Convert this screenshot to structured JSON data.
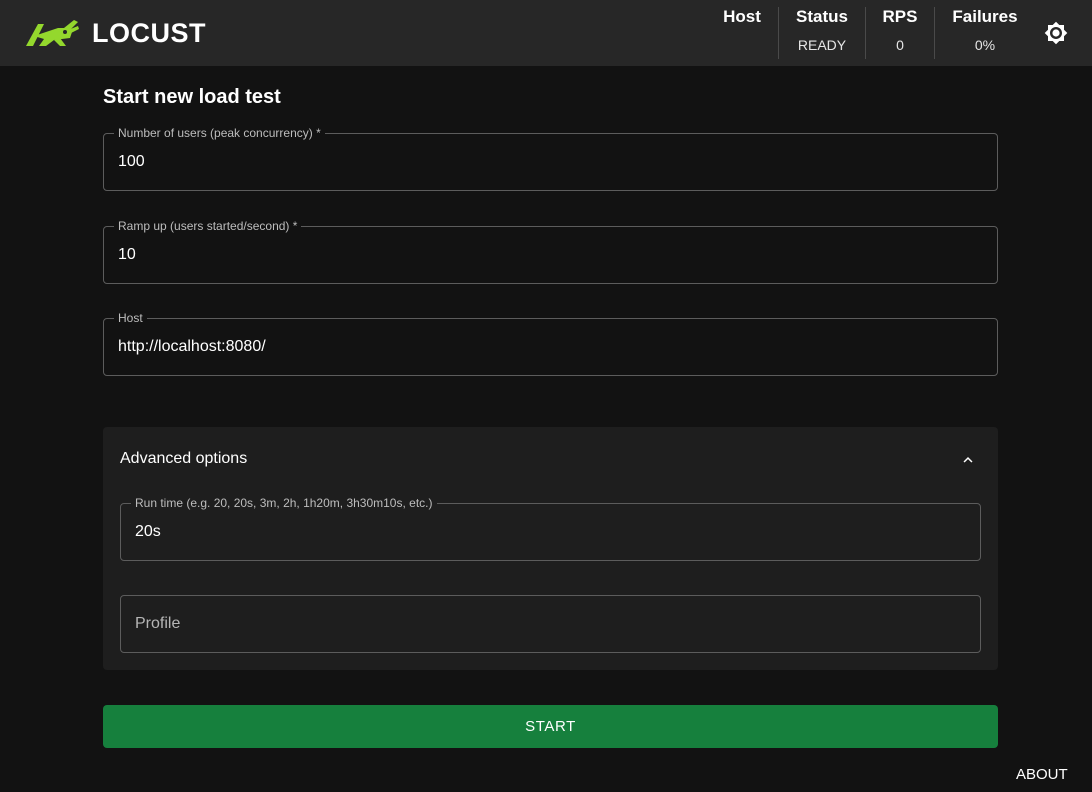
{
  "header": {
    "logo_text": "LOCUST",
    "stats": [
      {
        "label": "Host",
        "value": ""
      },
      {
        "label": "Status",
        "value": "READY"
      },
      {
        "label": "RPS",
        "value": "0"
      },
      {
        "label": "Failures",
        "value": "0%"
      }
    ],
    "theme_icon": "sun-icon",
    "accent_color": "#94d82d"
  },
  "form": {
    "title": "Start new load test",
    "users": {
      "label": "Number of users (peak concurrency) *",
      "value": "100"
    },
    "ramp_up": {
      "label": "Ramp up (users started/second) *",
      "value": "10"
    },
    "host": {
      "label": "Host",
      "value": "http://localhost:8080/"
    },
    "advanced": {
      "title": "Advanced options",
      "expanded": true,
      "run_time": {
        "label": "Run time (e.g. 20, 20s, 3m, 2h, 1h20m, 3h30m10s, etc.)",
        "value": "20s"
      },
      "profile": {
        "placeholder": "Profile",
        "value": ""
      }
    },
    "start_label": "START",
    "start_color": "#16803d"
  },
  "footer": {
    "about_label": "ABOUT"
  }
}
